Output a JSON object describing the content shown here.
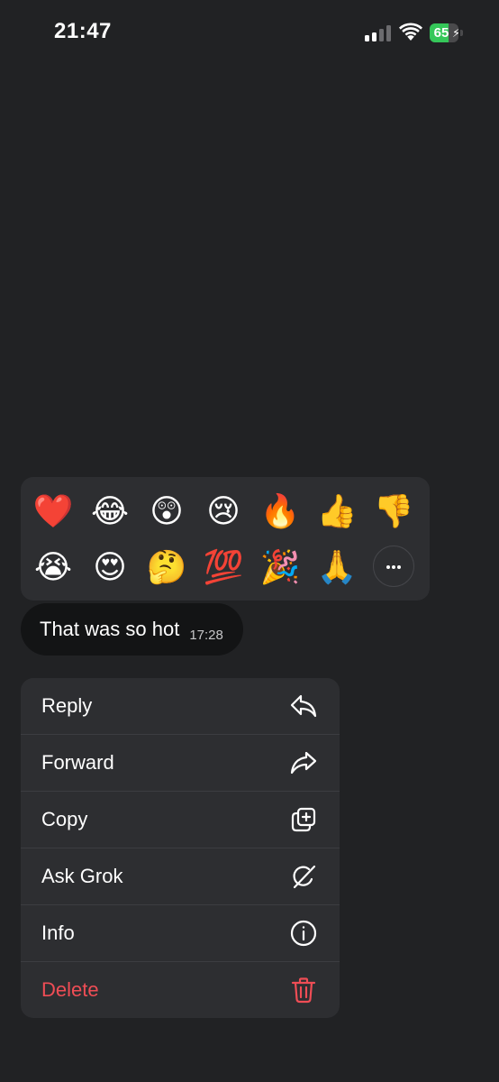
{
  "status_bar": {
    "time": "21:47",
    "battery_percent": "65",
    "battery_level": 0.65,
    "signal_bars_active": 2
  },
  "reactions": {
    "row1": [
      "❤️",
      "😂",
      "😲",
      "😢",
      "🔥",
      "👍",
      "👎"
    ],
    "row2": [
      "😭",
      "😍",
      "🤔",
      "💯",
      "🎉",
      "🙏"
    ],
    "more_icon": "more-horizontal-icon"
  },
  "message": {
    "text": "That was so hot",
    "time": "17:28"
  },
  "menu": {
    "items": [
      {
        "label": "Reply",
        "icon": "reply-icon"
      },
      {
        "label": "Forward",
        "icon": "forward-icon"
      },
      {
        "label": "Copy",
        "icon": "copy-icon"
      },
      {
        "label": "Ask Grok",
        "icon": "grok-icon"
      },
      {
        "label": "Info",
        "icon": "info-icon"
      },
      {
        "label": "Delete",
        "icon": "trash-icon"
      }
    ]
  },
  "colors": {
    "background": "#212224",
    "panel": "#2d2e31",
    "bubble": "#131415",
    "danger": "#ef4d55",
    "battery": "#35c759"
  }
}
